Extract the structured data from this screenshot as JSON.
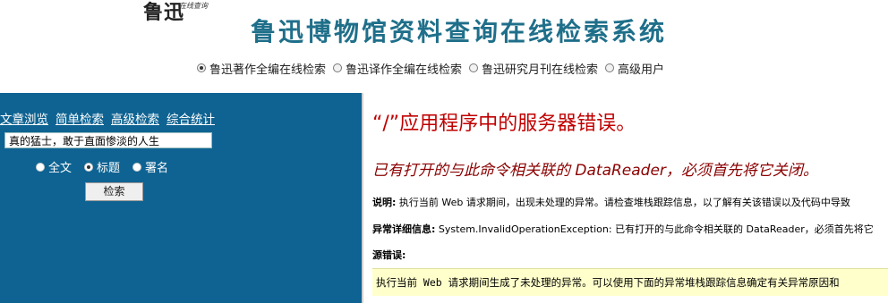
{
  "header": {
    "logo_text": "鲁迅",
    "logo_sub": "在线查询",
    "site_title": "鲁迅博物馆资料查询在线检索系统",
    "db_options": [
      {
        "label": "鲁迅著作全编在线检索",
        "selected": true
      },
      {
        "label": "鲁迅译作全编在线检索",
        "selected": false
      },
      {
        "label": "鲁迅研究月刊在线检索",
        "selected": false
      },
      {
        "label": "高级用户",
        "selected": false
      }
    ]
  },
  "sidebar": {
    "nav_links": [
      "文章浏览",
      "简单检索",
      "高级检索",
      "综合统计"
    ],
    "search_value": "真的猛士，敢于直面惨淡的人生",
    "scope_options": [
      {
        "label": "全文",
        "selected": false
      },
      {
        "label": "标题",
        "selected": true
      },
      {
        "label": "署名",
        "selected": false
      }
    ],
    "search_button": "检索"
  },
  "error": {
    "title": "“/”应用程序中的服务器错误。",
    "message": "已有打开的与此命令相关联的 DataReader，必须首先将它关闭。",
    "desc_label": "说明:",
    "desc_text": "执行当前 Web 请求期间，出现未处理的异常。请检查堆栈跟踪信息，以了解有关该错误以及代码中导致",
    "exc_label": "异常详细信息:",
    "exc_text": "System.InvalidOperationException: 已有打开的与此命令相关联的 DataReader，必须首先将它",
    "source_label": "源错误:",
    "source_text": "执行当前 Web 请求期间生成了未处理的异常。可以使用下面的异常堆栈跟踪信息确定有关异常原因和"
  },
  "colors": {
    "sidebar_bg": "#0e6392",
    "title": "#1f6f8a",
    "error_title": "#c00000",
    "error_message": "#8b0000",
    "code_bg": "#ffffcc"
  }
}
